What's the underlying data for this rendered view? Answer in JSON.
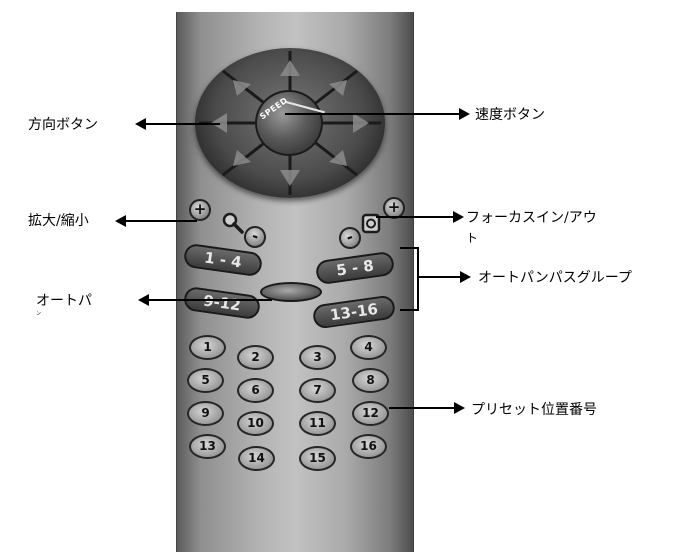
{
  "callouts": {
    "direction": "方向ボタン",
    "speed": "速度ボタン",
    "zoom": "拡大/縮小",
    "focus_line1": "フォーカスイン/アウ",
    "focus_line2": "ト",
    "autopan_group": "オートパンパスグループ",
    "autopan_line1": "オートパ",
    "autopan_line2": "ン",
    "preset": "プリセット位置番号"
  },
  "wheel": {
    "speed_text": "SPEED"
  },
  "zoom": {
    "in_label": "+",
    "out_label": "-"
  },
  "focus": {
    "in_label": "+",
    "out_label": "-"
  },
  "groups": [
    "1 - 4",
    "5 - 8",
    "9-12",
    "13-16"
  ],
  "presets": [
    "1",
    "2",
    "3",
    "4",
    "5",
    "6",
    "7",
    "8",
    "9",
    "10",
    "11",
    "12",
    "13",
    "14",
    "15",
    "16"
  ]
}
